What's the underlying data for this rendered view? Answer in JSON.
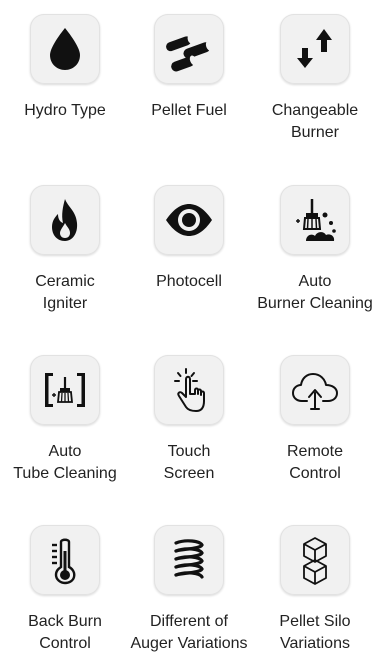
{
  "features": [
    {
      "icon": "water-drop-icon",
      "lines": [
        "Hydro Type"
      ]
    },
    {
      "icon": "pellet-fuel-icon",
      "lines": [
        "Pellet Fuel"
      ]
    },
    {
      "icon": "swap-arrows-icon",
      "lines": [
        "Changeable",
        "Burner"
      ]
    },
    {
      "icon": "flame-icon",
      "lines": [
        "Ceramic",
        "Igniter"
      ]
    },
    {
      "icon": "eye-icon",
      "lines": [
        "Photocell"
      ]
    },
    {
      "icon": "broom-cleaning-icon",
      "lines": [
        "Auto",
        "Burner Cleaning"
      ]
    },
    {
      "icon": "tube-cleaning-icon",
      "lines": [
        "Auto",
        "Tube Cleaning"
      ]
    },
    {
      "icon": "touch-hand-icon",
      "lines": [
        "Touch",
        "Screen"
      ]
    },
    {
      "icon": "cloud-upload-icon",
      "lines": [
        "Remote",
        "Control"
      ]
    },
    {
      "icon": "thermometer-icon",
      "lines": [
        "Back Burn",
        "Control"
      ]
    },
    {
      "icon": "spring-coil-icon",
      "lines": [
        "Different of",
        "Auger Variations"
      ]
    },
    {
      "icon": "stacked-cubes-icon",
      "lines": [
        "Pellet Silo",
        "Variations"
      ]
    }
  ]
}
